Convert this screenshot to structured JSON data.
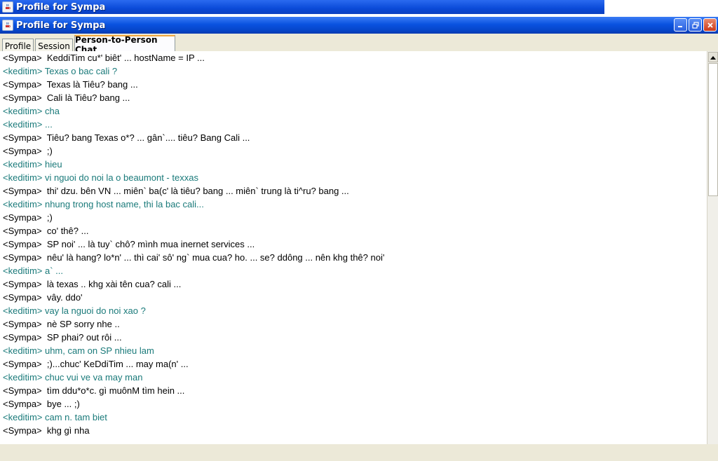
{
  "background_window": {
    "title": "Profile for Sympa"
  },
  "window": {
    "title": "Profile for Sympa",
    "icons": {
      "app": "java-cup-icon",
      "minimize": "minimize-icon",
      "maximize": "restore-icon",
      "close": "close-icon"
    },
    "colors": {
      "titlebar": "#0a52e0",
      "close": "#cc3b1b"
    }
  },
  "tabs": [
    {
      "label": "Profile"
    },
    {
      "label": "Session"
    },
    {
      "label": "Person-to-Person Chat",
      "active": true
    }
  ],
  "chat": {
    "colors": {
      "sympa": "#000000",
      "keditim": "#1a7a7a"
    },
    "lines": [
      {
        "speaker": "sympa",
        "text": "<Sympa>  KeddiTim cu*' biêt' ... hostName = IP ..."
      },
      {
        "speaker": "keditim",
        "text": "<keditim> Texas o bac cali ?"
      },
      {
        "speaker": "sympa",
        "text": "<Sympa>  Texas là Tiêu? bang ..."
      },
      {
        "speaker": "sympa",
        "text": "<Sympa>  Cali là Tiêu? bang ..."
      },
      {
        "speaker": "keditim",
        "text": "<keditim> cha"
      },
      {
        "speaker": "keditim",
        "text": "<keditim> ..."
      },
      {
        "speaker": "sympa",
        "text": "<Sympa>  Tiêu? bang Texas o*? ... gân`.... tiêu? Bang Cali ..."
      },
      {
        "speaker": "sympa",
        "text": "<Sympa>  ;)"
      },
      {
        "speaker": "keditim",
        "text": "<keditim> hieu"
      },
      {
        "speaker": "keditim",
        "text": "<keditim> vi nguoi do noi la o beaumont - texxas"
      },
      {
        "speaker": "sympa",
        "text": "<Sympa>  thi' dzu. bên VN ... miên` ba(c' là tiêu? bang ... miên` trung là ti^ru? bang ..."
      },
      {
        "speaker": "keditim",
        "text": "<keditim> nhung trong host name, thi la bac cali..."
      },
      {
        "speaker": "sympa",
        "text": "<Sympa>  ;)"
      },
      {
        "speaker": "sympa",
        "text": "<Sympa>  co' thê? ..."
      },
      {
        "speaker": "sympa",
        "text": "<Sympa>  SP noi' ... là tuy` chô? mình mua inernet services ..."
      },
      {
        "speaker": "sympa",
        "text": "<Sympa>  nêu' là hang? lo*n' ... thì cai' sô' ng` mua cua? ho. ... se? ddông ... nên khg thê? noi'"
      },
      {
        "speaker": "keditim",
        "text": "<keditim> a` ..."
      },
      {
        "speaker": "sympa",
        "text": "<Sympa>  là texas .. khg xài tên cua? cali ..."
      },
      {
        "speaker": "sympa",
        "text": "<Sympa>  vây. ddo'"
      },
      {
        "speaker": "keditim",
        "text": "<keditim> vay la nguoi do noi xao ?"
      },
      {
        "speaker": "sympa",
        "text": "<Sympa>  nè SP sorry nhe .."
      },
      {
        "speaker": "sympa",
        "text": "<Sympa>  SP phai? out rôi ..."
      },
      {
        "speaker": "keditim",
        "text": "<keditim> uhm, cam on SP nhieu lam"
      },
      {
        "speaker": "sympa",
        "text": "<Sympa>  ;)...chuc' KeDdiTim ... may ma(n' ..."
      },
      {
        "speaker": "keditim",
        "text": "<keditim> chuc vui ve va may man"
      },
      {
        "speaker": "sympa",
        "text": "<Sympa>  tìm ddu*o*c. gì muônM tìm hein ..."
      },
      {
        "speaker": "sympa",
        "text": "<Sympa>  bye ... ;)"
      },
      {
        "speaker": "keditim",
        "text": "<keditim> cam n. tam biet"
      },
      {
        "speaker": "sympa",
        "text": "<Sympa>  khg gì nha"
      }
    ]
  },
  "scrollbar": {
    "up_icon": "arrow-up-icon"
  }
}
